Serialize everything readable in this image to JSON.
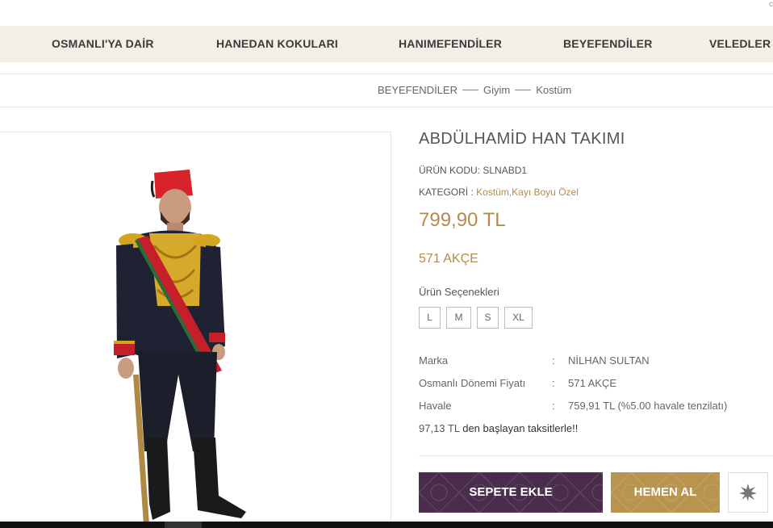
{
  "top": {
    "corner_glyph": "c"
  },
  "nav": {
    "items": [
      {
        "label": "OSMANLI'YA DAİR"
      },
      {
        "label": "HANEDAN KOKULARI"
      },
      {
        "label": "HANIMEFENDİLER"
      },
      {
        "label": "BEYEFENDİLER"
      },
      {
        "label": "VELEDLER"
      }
    ]
  },
  "breadcrumb": {
    "items": [
      {
        "label": "BEYEFENDİLER"
      },
      {
        "label": "Giyim"
      },
      {
        "label": "Kostüm"
      }
    ]
  },
  "product": {
    "title": "ABDÜLHAMİD HAN TAKIMI",
    "code_label": "ÜRÜN KODU:",
    "code_value": "SLNABD1",
    "category_label": "KATEGORİ :",
    "category_links": "Kostüm,Kayı Boyu Özel",
    "price": "799,90 TL",
    "akce": "571 AKÇE",
    "options_label": "Ürün Seçenekleri",
    "options": [
      "L",
      "M",
      "S",
      "XL"
    ],
    "specs": [
      {
        "key": "Marka",
        "colon": ":",
        "value": "NİLHAN SULTAN"
      },
      {
        "key": "Osmanlı Dönemi Fiyatı",
        "colon": ":",
        "value": "571 AKÇE"
      },
      {
        "key": "Havale",
        "colon": ":",
        "value": "759,91 TL (%5.00 havale tenzilatı)"
      }
    ],
    "installment_amount": "97,13 TL",
    "installment_text": " den başlayan taksitlerle!!"
  },
  "actions": {
    "add_to_cart": "SEPETE EKLE",
    "buy_now": "HEMEN AL",
    "favorite_icon": "star-burst-icon"
  },
  "colors": {
    "nav_bg": "#f4efe6",
    "accent_gold": "#b8894f",
    "cart_purple": "#4a2d4c",
    "buy_gold": "#b8944f"
  }
}
